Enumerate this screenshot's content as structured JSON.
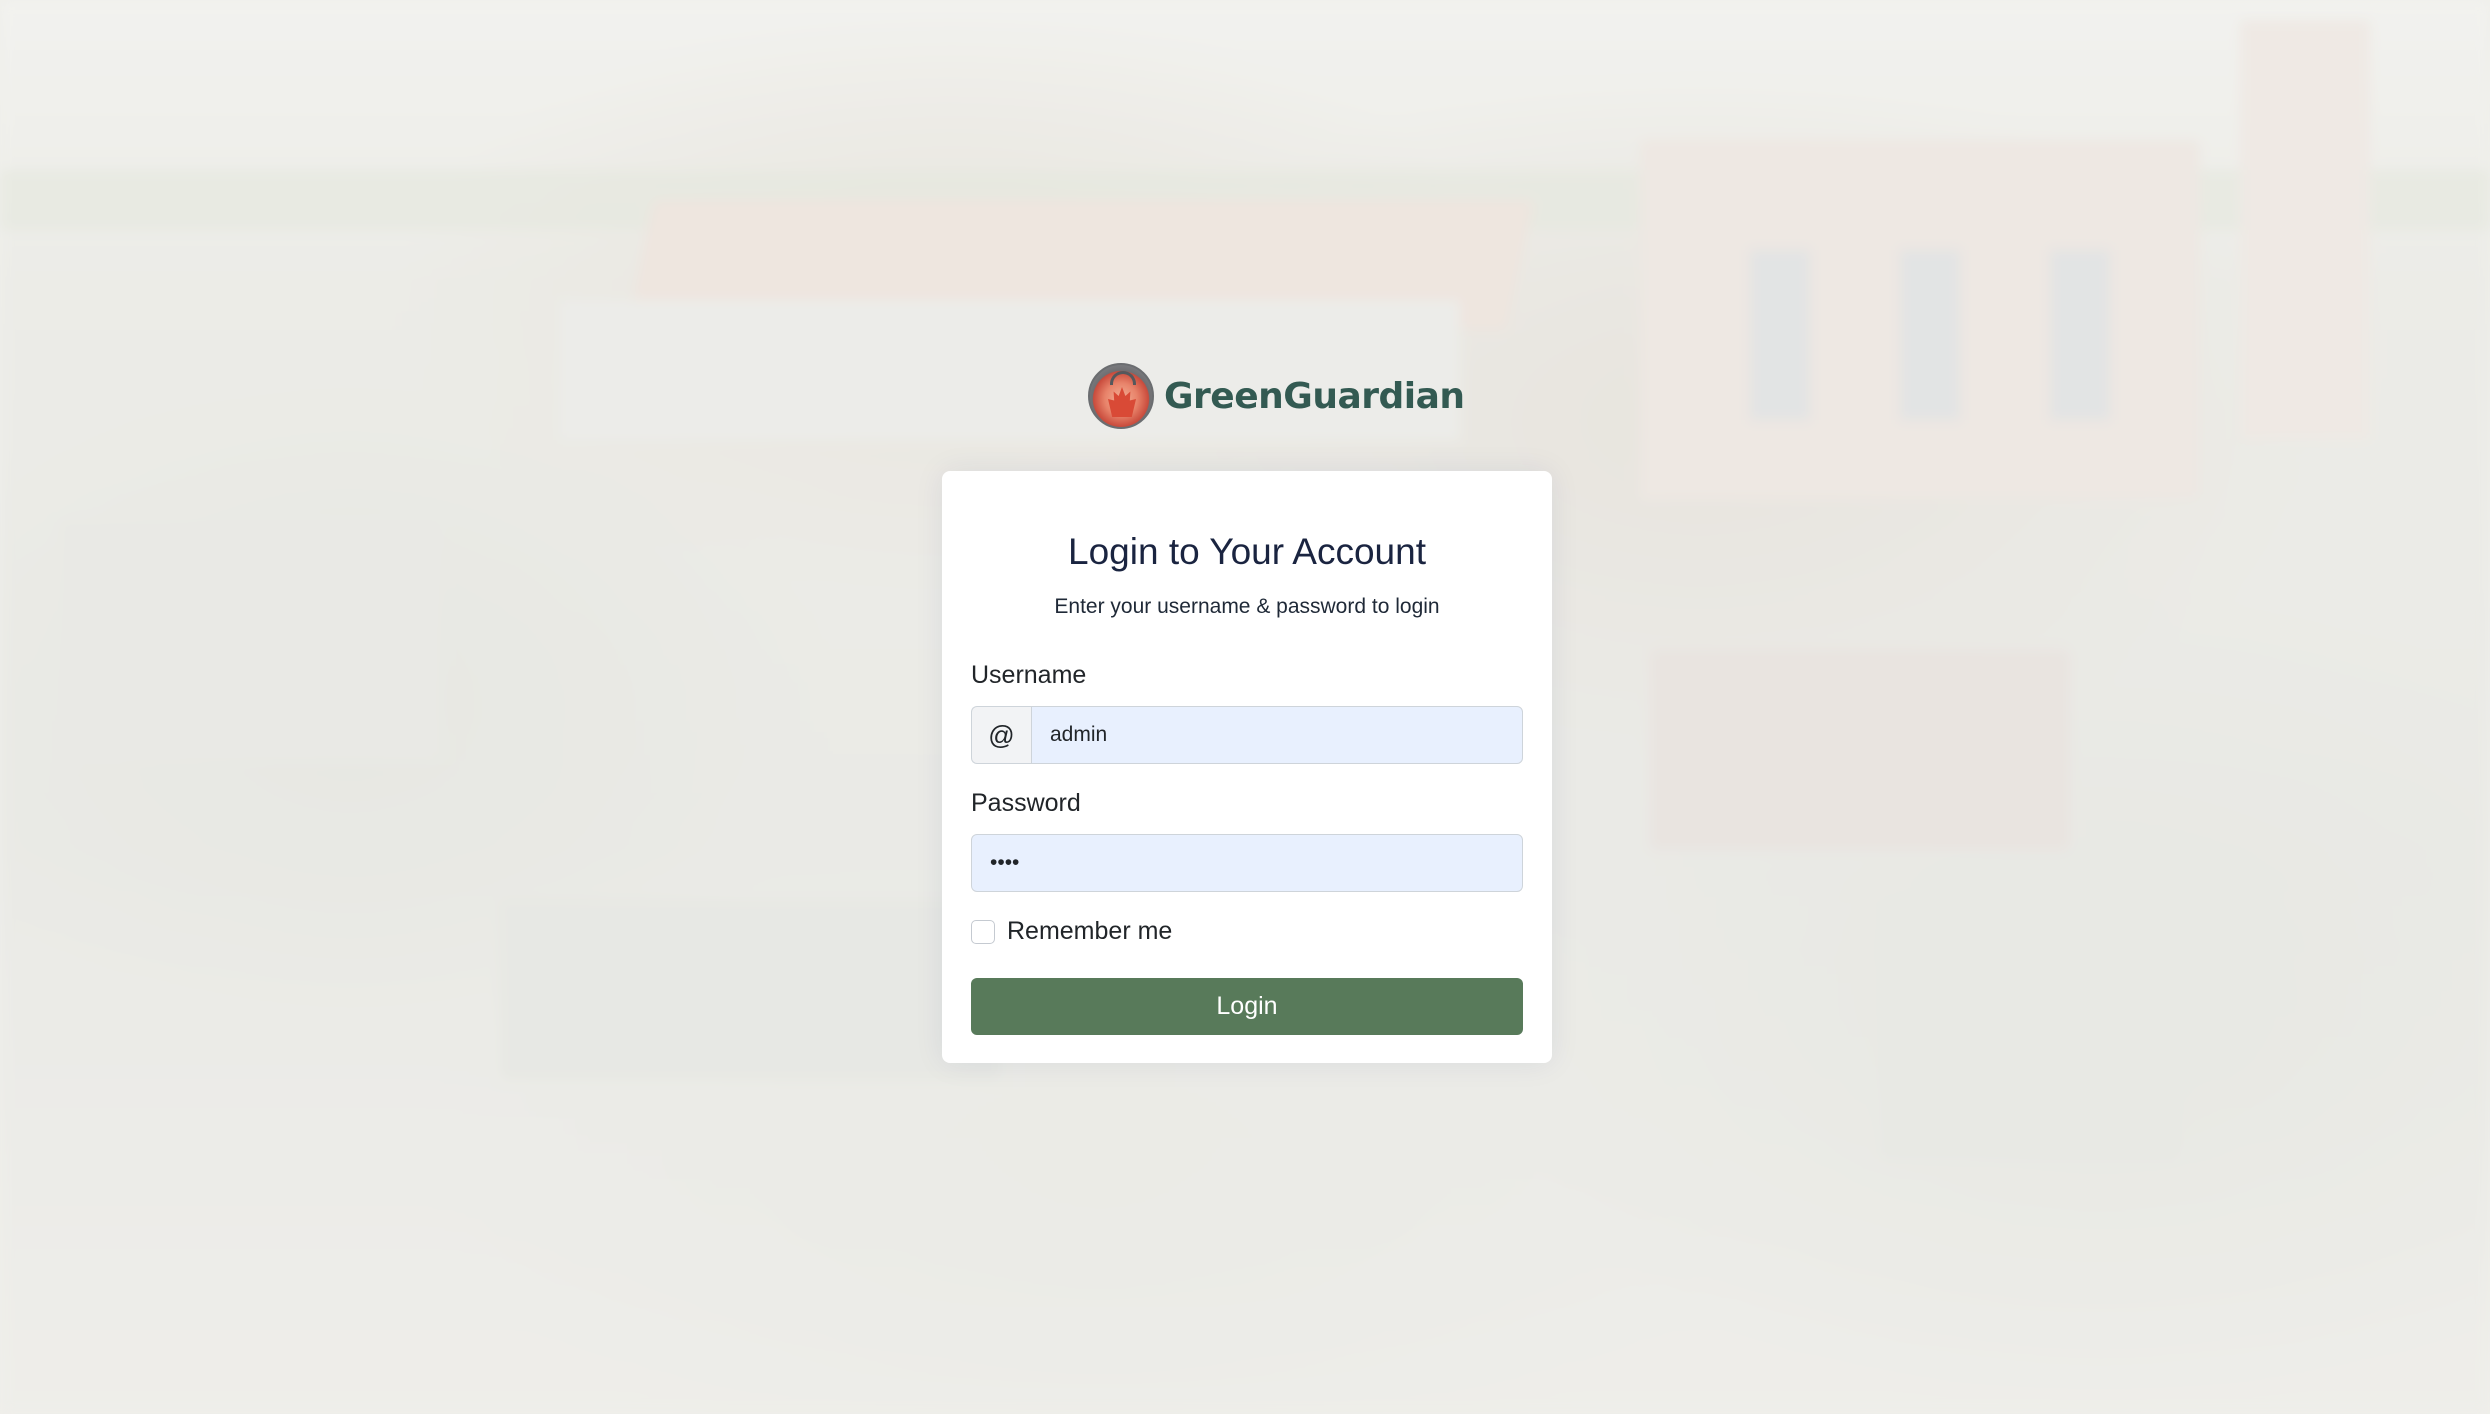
{
  "brand": {
    "name": "GreenGuardian",
    "logo_icon": "greenguardian-logo-icon"
  },
  "login": {
    "title": "Login to Your Account",
    "subtitle": "Enter your username & password to login",
    "username_label": "Username",
    "username_prefix": "@",
    "username_value": "admin",
    "password_label": "Password",
    "password_value": "••••",
    "remember_label": "Remember me",
    "remember_checked": false,
    "submit_label": "Login"
  },
  "colors": {
    "brand_text": "#335a52",
    "button": "#587a5a",
    "autofill_field": "#e8f0fe"
  }
}
